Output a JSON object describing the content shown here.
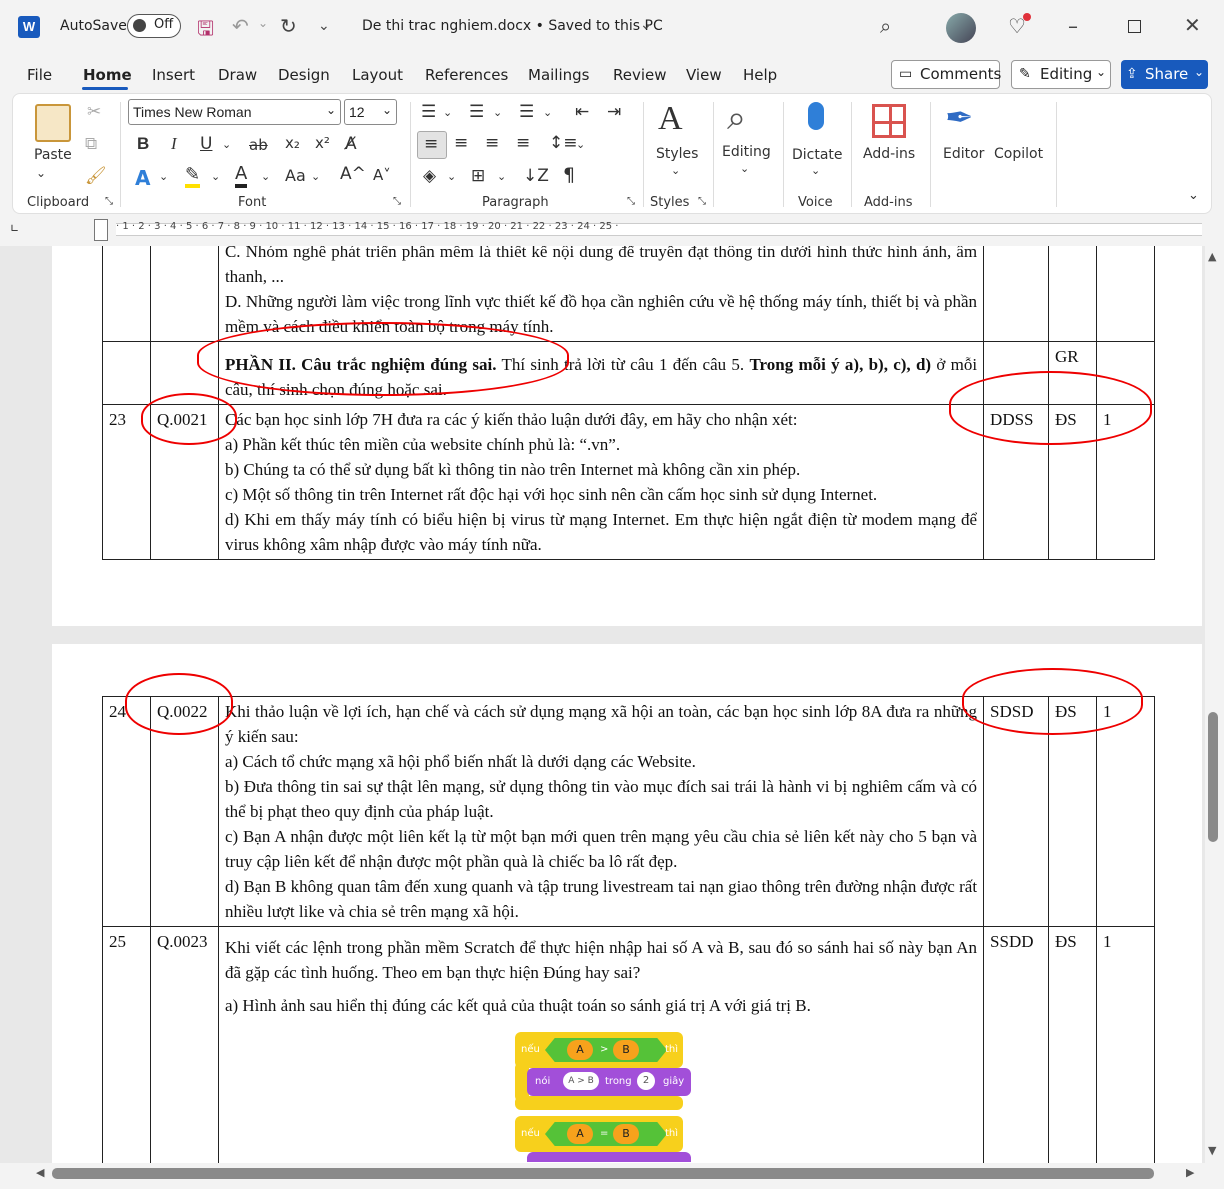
{
  "titlebar": {
    "app_icon": "W",
    "autosave_label": "AutoSave",
    "autosave_state": "Off",
    "document_title": "De thi trac nghiem.docx • Saved to this PC"
  },
  "menu": {
    "tabs": [
      "File",
      "Home",
      "Insert",
      "Draw",
      "Design",
      "Layout",
      "References",
      "Mailings",
      "Review",
      "View",
      "Help"
    ],
    "comments": "Comments",
    "editing": "Editing",
    "share": "Share"
  },
  "ribbon": {
    "clipboard": {
      "paste": "Paste",
      "label": "Clipboard"
    },
    "font": {
      "name": "Times New Roman",
      "size": "12",
      "label": "Font",
      "bold": "B",
      "italic": "I",
      "underline": "U",
      "strike": "ab",
      "sub": "x₂",
      "sup": "x²",
      "font_color": "A",
      "case": "Aa",
      "grow": "A^",
      "shrink": "A˅"
    },
    "paragraph": {
      "label": "Paragraph",
      "pilcrow": "¶"
    },
    "styles": {
      "button": "Styles",
      "label": "Styles"
    },
    "editing": {
      "button": "Editing"
    },
    "voice": {
      "button": "Dictate",
      "label": "Voice"
    },
    "addins": {
      "button": "Add-ins",
      "label": "Add-ins"
    },
    "editor": {
      "button": "Editor"
    },
    "copilot": {
      "button": "Copilot"
    }
  },
  "ruler": {
    "marks": "· 1 · 2 · 3 · 4 · 5 · 6 · 7 · 8 · 9 · 10 · 11 · 12 · 13 · 14 · 15 · 16 · 17 · 18 · 19 · 20 · 21 · 22 · 23 · 24 · 25 ·"
  },
  "page1": {
    "row_c_cont": "C.  Nhóm nghề phát triển phần mềm là thiết kế nội dung để truyền đạt thông tin dưới hình thức hình ảnh, âm thanh, ...",
    "row_d": "D.  Những người làm việc trong lĩnh vực thiết kế đồ họa cần nghiên cứu về hệ thống máy tính, thiết bị và phần mềm và cách điều khiển toàn bộ trong máy tính.",
    "part2_bold": "PHẦN II. Câu trắc nghiệm đúng sai.",
    "part2_text": " Thí sinh trả lời từ câu 1 đến câu 5. ",
    "part2_bold2": "Trong mỗi ý a), b), c), d)",
    "part2_text2": " ở mỗi câu, thí sinh chọn đúng hoặc sai.",
    "part2_type": "GR",
    "q23": {
      "num": "23",
      "code": "Q.0021",
      "answer": "DDSS",
      "type": "ĐS",
      "score": "1",
      "stem": "Các bạn học sinh lớp 7H đưa ra các ý kiến thảo luận dưới đây, em hãy cho nhận xét:",
      "a": "a) Phần kết thúc tên miền của website chính phủ là: “.vn”.",
      "b": "b) Chúng ta có thể sử dụng bất kì thông tin nào trên Internet mà không cần xin phép.",
      "c": "c) Một số thông tin trên Internet rất độc hại với học sinh nên cần cấm học sinh sử dụng Internet.",
      "d": "d) Khi em thấy máy tính có biểu hiện bị virus từ mạng Internet. Em thực hiện ngắt điện từ modem mạng để virus không xâm nhập được vào máy tính nữa."
    }
  },
  "page2": {
    "q24": {
      "num": "24",
      "code": "Q.0022",
      "answer": "SDSD",
      "type": "ĐS",
      "score": "1",
      "stem": "Khi thảo luận về lợi ích, hạn chế và cách sử dụng mạng xã hội an toàn, các bạn học sinh lớp 8A đưa ra những ý kiến sau:",
      "a": "a) Cách tổ chức mạng xã hội phổ biến nhất là dưới dạng các Website.",
      "b": "b) Đưa thông tin sai sự thật lên mạng, sử dụng thông tin vào mục đích sai trái là hành vi bị nghiêm cấm và có thể bị phạt theo quy định của pháp luật.",
      "c": "c) Bạn A nhận được một liên kết lạ từ một bạn mới quen trên mạng yêu cầu chia sẻ liên kết này cho 5 bạn và truy cập liên kết để nhận được một phần quà là chiếc ba lô rất đẹp.",
      "d": "d) Bạn B không quan tâm đến xung quanh và tập trung livestream tai nạn giao thông trên đường nhận được rất nhiều lượt like và chia sẻ trên mạng xã hội."
    },
    "q25": {
      "num": "25",
      "code": "Q.0023",
      "answer": "SSDD",
      "type": "ĐS",
      "score": "1",
      "stem": " Khi viết các lệnh trong phần mềm Scratch để thực hiện nhập hai số A và B, sau đó so sánh hai số này bạn An đã gặp các tình huống. Theo em bạn thực hiện Đúng hay sai?",
      "a": "a) Hình ảnh sau hiển thị đúng các kết quả của thuật toán so sánh giá trị A với giá trị B."
    },
    "scratch": {
      "if1": "nếu",
      "then1": "thì",
      "a1": "A",
      "op1": ">",
      "b1": "B",
      "say": "nói",
      "say_text": "A > B",
      "for": "trong",
      "secs": "2",
      "unit": "giây",
      "if2": "nếu",
      "then2": "thì",
      "a2": "A",
      "op2": "=",
      "b2": "B"
    }
  }
}
